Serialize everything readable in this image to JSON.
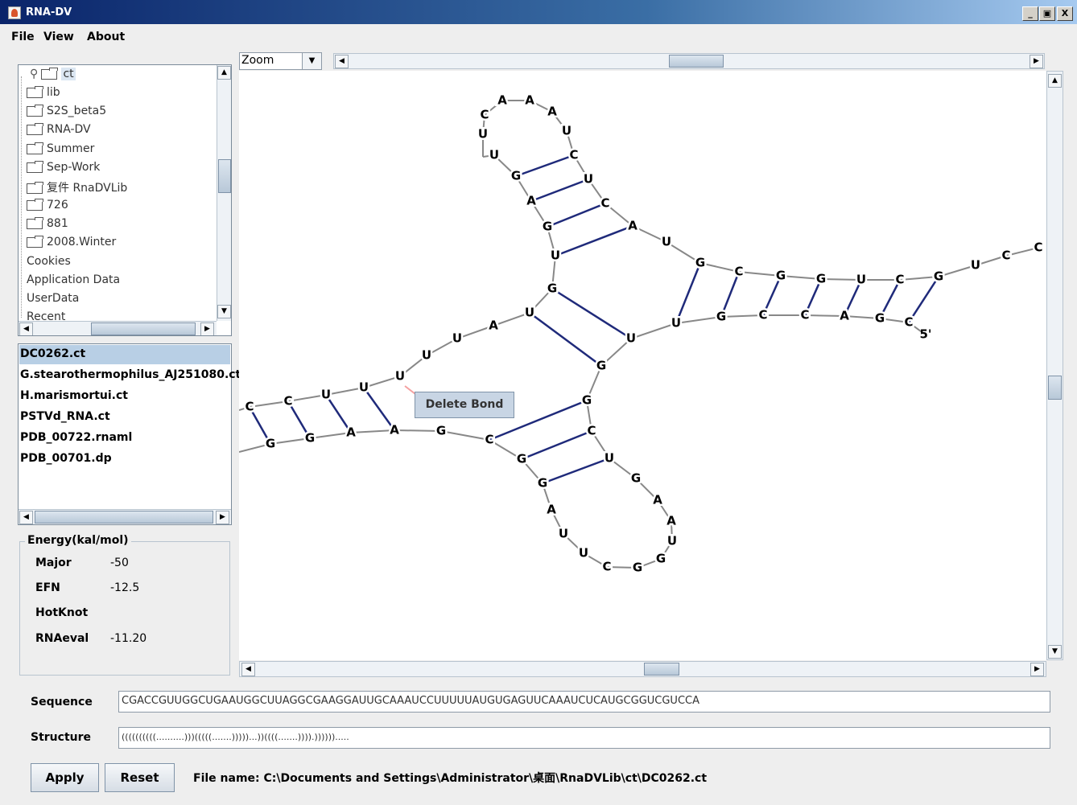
{
  "window": {
    "title": "RNA-DV",
    "controls": [
      "_",
      "▣",
      "X"
    ]
  },
  "menu": {
    "file": "File",
    "view": "View",
    "about": "About"
  },
  "tree": {
    "root": "ct",
    "items": [
      "lib",
      "S2S_beta5",
      "RNA-DV",
      "Summer",
      "Sep-Work",
      "复件 RnaDVLib",
      "726",
      "881",
      "2008.Winter"
    ],
    "outer_items": [
      "Cookies",
      "Application Data",
      "UserData",
      "Recent"
    ]
  },
  "files": {
    "items": [
      "DC0262.ct",
      "G.stearothermophilus_AJ251080.ct",
      "H.marismortui.ct",
      "PSTVd_RNA.ct",
      "PDB_00722.rnaml",
      "PDB_00701.dp"
    ],
    "selected": "DC0262.ct"
  },
  "energy": {
    "legend": "Energy(kal/mol)",
    "rows": [
      {
        "label": "Major",
        "value": "-50"
      },
      {
        "label": "EFN",
        "value": "-12.5"
      },
      {
        "label": "HotKnot",
        "value": ""
      },
      {
        "label": "RNAeval",
        "value": "-11.20"
      }
    ]
  },
  "toolbar": {
    "zoom_label": "Zoom"
  },
  "context_menu": {
    "delete_bond": "Delete Bond"
  },
  "sequence": {
    "label": "Sequence",
    "value": "CGACCGUUGGCUGAAUGGCUUAGGCGAAGGAUUGCAAAUCCUUUUUAUGUGAGUUCAAAUCUCAUGCGGUCGUCCA"
  },
  "structure": {
    "label": "Structure",
    "value": "((((((((((..........)))(((((.......)))))...))((((.......)))).))))))....."
  },
  "buttons": {
    "apply": "Apply",
    "reset": "Reset"
  },
  "status": {
    "filename": "File name: C:\\Documents and Settings\\Administrator\\桌面\\RnaDVLib\\ct\\DC0262.ct"
  },
  "rna": {
    "five_prime": "5'",
    "colors": {
      "pair": "#1f2a7a",
      "backbone": "#888888"
    }
  }
}
